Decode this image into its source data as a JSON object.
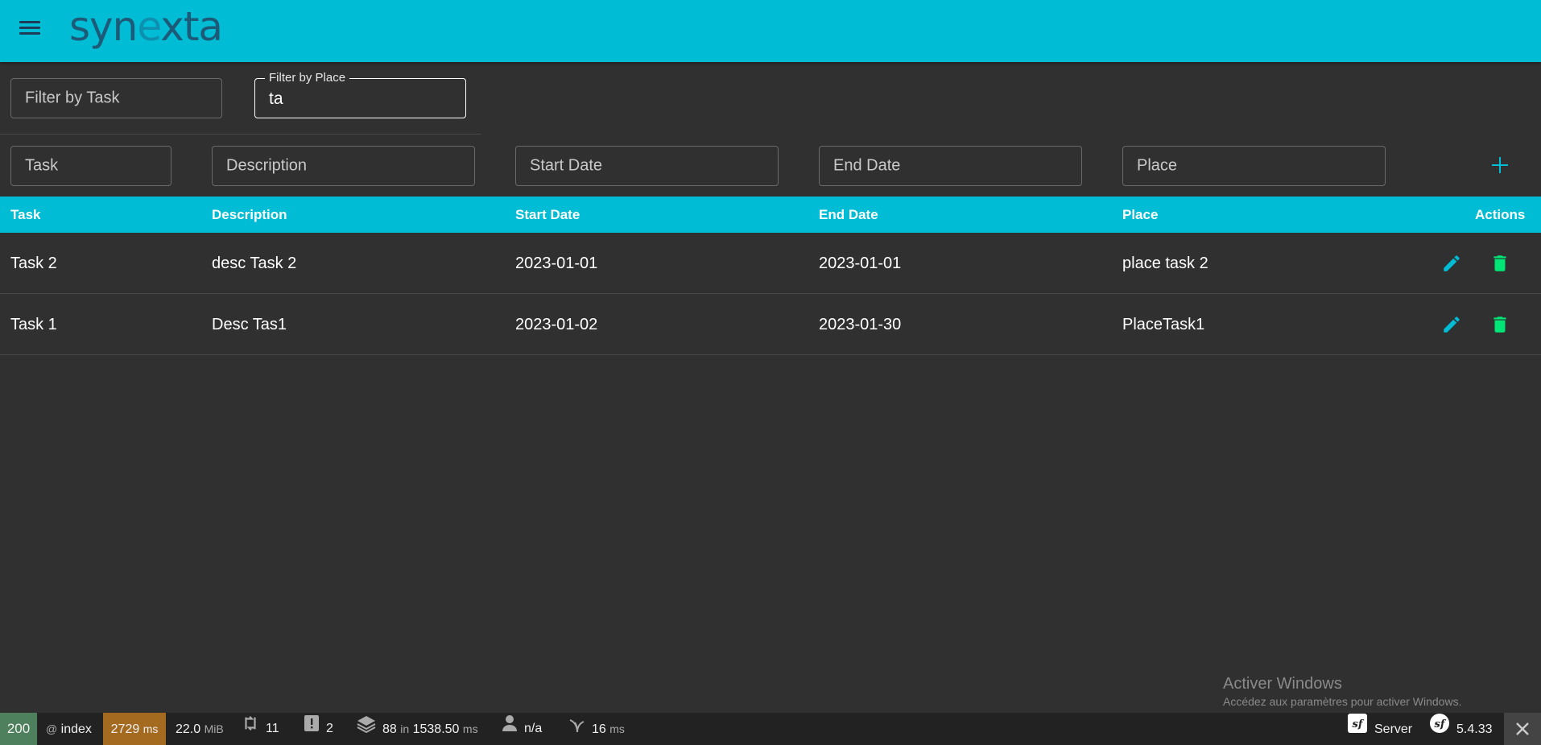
{
  "app": {
    "logo_text_1": "syn",
    "logo_text_x": "e",
    "logo_text_2": "xta"
  },
  "filters": {
    "task_placeholder": "Filter by Task",
    "place_label": "Filter by Place",
    "place_value": "ta"
  },
  "new_row": {
    "task": "Task",
    "description": "Description",
    "start_date": "Start Date",
    "end_date": "End Date",
    "place": "Place"
  },
  "table": {
    "headers": {
      "task": "Task",
      "description": "Description",
      "start_date": "Start Date",
      "end_date": "End Date",
      "place": "Place",
      "actions": "Actions"
    },
    "rows": [
      {
        "task": "Task 2",
        "description": "desc Task 2",
        "start_date": "2023-01-01",
        "end_date": "2023-01-01",
        "place": "place task 2"
      },
      {
        "task": "Task 1",
        "description": "Desc Tas1",
        "start_date": "2023-01-02",
        "end_date": "2023-01-30",
        "place": "PlaceTask1"
      }
    ]
  },
  "debug_bar": {
    "status_code": "200",
    "route": "index",
    "time": "2729",
    "time_unit": "ms",
    "memory": "22.0",
    "memory_unit": "MiB",
    "requests": "11",
    "logs": "2",
    "queries": "88",
    "queries_in": "in",
    "queries_time": "1538.50",
    "queries_time_unit": "ms",
    "user": "n/a",
    "twig_time": "16",
    "twig_unit": "ms",
    "server_label": "Server",
    "version": "5.4.33"
  },
  "watermark": {
    "line1": "Activer Windows",
    "line2": "Accédez aux paramètres pour activer Windows."
  },
  "colors": {
    "accent": "#00bcd4",
    "delete": "#00e676",
    "background": "#303030",
    "status_ok": "#4f805d",
    "time_warn": "#a46a1f"
  }
}
